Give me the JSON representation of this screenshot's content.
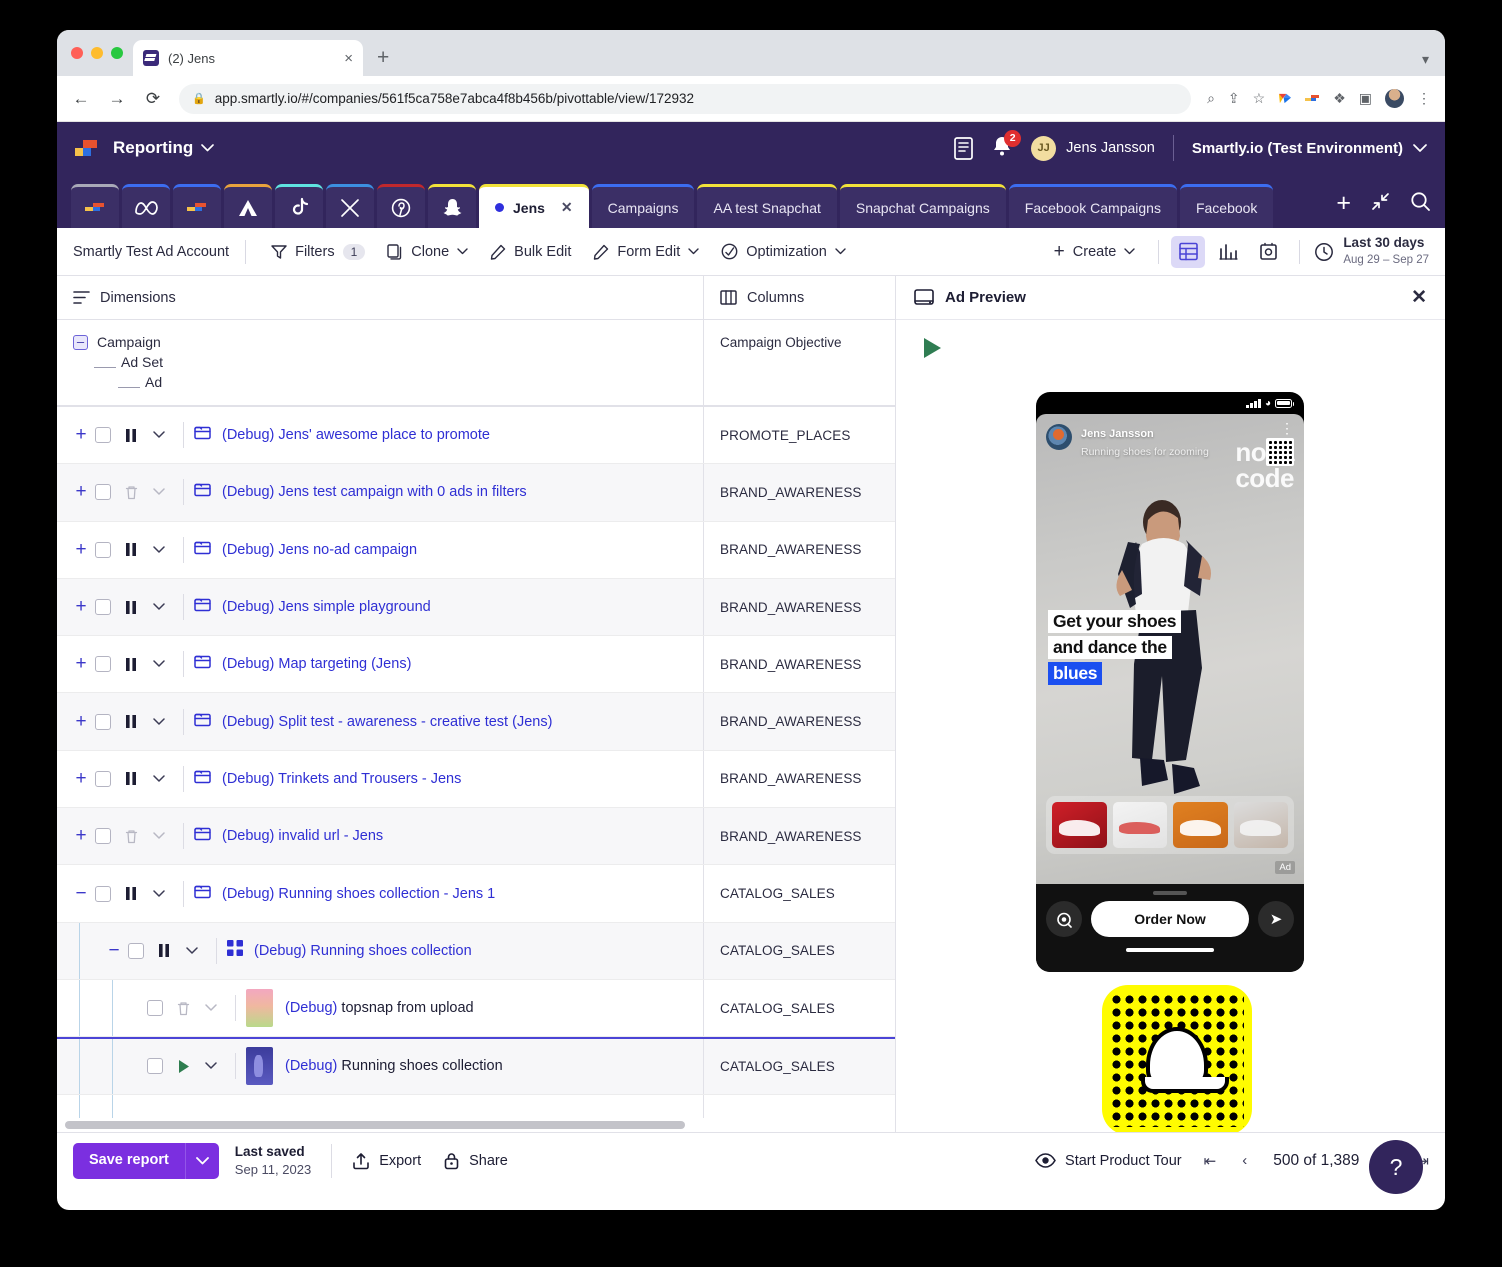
{
  "browser": {
    "tab_title": "(2) Jens",
    "url": "app.smartly.io/#/companies/561f5ca758e7abca4f8b456b/pivottable/view/172932",
    "new_tab_label": "+",
    "close_label": "×"
  },
  "topbar": {
    "app_name": "Reporting",
    "notification_count": "2",
    "user_initials": "JJ",
    "user_name": "Jens Jansson",
    "org_name": "Smartly.io (Test Environment)"
  },
  "tabs": {
    "icon_tabs": [
      {
        "name": "smartly",
        "accent": "#a9a9b8"
      },
      {
        "name": "meta",
        "accent": "#3c6df0"
      },
      {
        "name": "smartly-2",
        "accent": "#3c6df0"
      },
      {
        "name": "adobe",
        "accent": "#e8a33d"
      },
      {
        "name": "tiktok",
        "accent": "#5fe3e0"
      },
      {
        "name": "x",
        "accent": "#3c8fe0"
      },
      {
        "name": "pinterest",
        "accent": "#c0282d"
      },
      {
        "name": "snapchat",
        "accent": "#f2e23a"
      }
    ],
    "items": [
      {
        "label": "Jens",
        "active": true,
        "accent": "#f2e23a"
      },
      {
        "label": "Campaigns",
        "active": false,
        "accent": "#3c6df0"
      },
      {
        "label": "AA test Snapchat",
        "active": false,
        "accent": "#f2e23a"
      },
      {
        "label": "Snapchat Campaigns",
        "active": false,
        "accent": "#f2e23a"
      },
      {
        "label": "Facebook Campaigns",
        "active": false,
        "accent": "#3c6df0"
      },
      {
        "label": "Facebook",
        "active": false,
        "accent": "#3c6df0"
      }
    ],
    "next_label": "›",
    "add_label": "+"
  },
  "toolbar": {
    "account": "Smartly Test Ad Account",
    "filters_label": "Filters",
    "filters_count": "1",
    "clone_label": "Clone",
    "bulk_edit_label": "Bulk Edit",
    "form_edit_label": "Form Edit",
    "optimization_label": "Optimization",
    "create_label": "Create",
    "date_label": "Last 30 days",
    "date_range": "Aug 29 – Sep 27"
  },
  "grid": {
    "dimensions_header": "Dimensions",
    "columns_header": "Columns",
    "dimension_tree": [
      "Campaign",
      "Ad Set",
      "Ad"
    ],
    "column_name": "Campaign Objective",
    "rows": [
      {
        "name": "(Debug) Jens' awesome place to promote",
        "objective": "PROMOTE_PLACES",
        "level": 0,
        "expander": "+",
        "status": "pause",
        "icon": "campaign-folder"
      },
      {
        "name": "(Debug) Jens test campaign with 0 ads in filters",
        "objective": "BRAND_AWARENESS",
        "level": 0,
        "expander": "+",
        "status": "trash",
        "icon": "campaign-folder"
      },
      {
        "name": "(Debug) Jens no-ad campaign",
        "objective": "BRAND_AWARENESS",
        "level": 0,
        "expander": "+",
        "status": "pause",
        "icon": "campaign-folder"
      },
      {
        "name": "(Debug) Jens simple playground",
        "objective": "BRAND_AWARENESS",
        "level": 0,
        "expander": "+",
        "status": "pause",
        "icon": "campaign-folder"
      },
      {
        "name": "(Debug) Map targeting (Jens)",
        "objective": "BRAND_AWARENESS",
        "level": 0,
        "expander": "+",
        "status": "pause",
        "icon": "campaign-folder"
      },
      {
        "name": "(Debug) Split test - awareness - creative test (Jens)",
        "objective": "BRAND_AWARENESS",
        "level": 0,
        "expander": "+",
        "status": "pause",
        "icon": "campaign-folder"
      },
      {
        "name": "(Debug) Trinkets and Trousers - Jens",
        "objective": "BRAND_AWARENESS",
        "level": 0,
        "expander": "+",
        "status": "pause",
        "icon": "campaign-folder"
      },
      {
        "name": "(Debug) invalid url - Jens",
        "objective": "BRAND_AWARENESS",
        "level": 0,
        "expander": "+",
        "status": "trash",
        "icon": "campaign-folder"
      },
      {
        "name": "(Debug) Running shoes collection - Jens 1",
        "objective": "CATALOG_SALES",
        "level": 0,
        "expander": "−",
        "status": "pause",
        "icon": "campaign-folder"
      },
      {
        "name": "(Debug) Running shoes collection",
        "objective": "CATALOG_SALES",
        "level": 1,
        "expander": "−",
        "status": "pause",
        "icon": "adset-grid"
      },
      {
        "name": "(Debug) topsnap from upload",
        "objective": "CATALOG_SALES",
        "level": 2,
        "expander": "",
        "status": "trash",
        "icon": "thumb-a"
      },
      {
        "name": "(Debug) Running shoes collection",
        "objective": "CATALOG_SALES",
        "level": 2,
        "expander": "",
        "status": "play",
        "icon": "thumb-b"
      }
    ]
  },
  "preview": {
    "title": "Ad Preview",
    "close_label": "✕",
    "ad": {
      "profile_name": "Jens Jansson",
      "profile_subtitle": "Running shoes for zooming",
      "brand_line1": "nova",
      "brand_line2": "code",
      "copy_line1": "Get your shoes",
      "copy_line2": "and dance the",
      "copy_line3": "blues",
      "ad_tag": "Ad",
      "cta_label": "Order Now",
      "kebab": "⋮"
    }
  },
  "bottom": {
    "save_label": "Save report",
    "save_caret": "⌄",
    "last_saved_label": "Last saved",
    "last_saved_date": "Sep 11, 2023",
    "export_label": "Export",
    "share_label": "Share",
    "product_tour_label": "Start Product Tour",
    "pagination": "500 of 1,389",
    "help_label": "?"
  },
  "colors": {
    "brand_purple": "#32255c",
    "accent_violet": "#7b2fe0",
    "link_blue": "#2f2fd4",
    "snap_yellow": "#FFFC00",
    "badge_red": "#e02f2f"
  }
}
